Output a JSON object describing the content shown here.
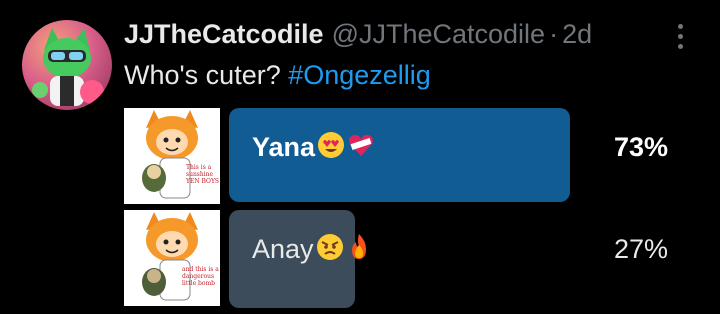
{
  "tweet": {
    "display_name": "JJTheCatcodile",
    "handle": "@JJTheCatcodile",
    "separator": "·",
    "time": "2d",
    "text_prefix": "Who's cuter? ",
    "hashtag": "#Ongezellig"
  },
  "poll": {
    "options": [
      {
        "label": "Yana",
        "percent": "73%",
        "value": 73,
        "winner": true,
        "emoji": [
          "heart-eyes-emoji",
          "bandaged-heart-emoji"
        ]
      },
      {
        "label": "Anay",
        "percent": "27%",
        "value": 27,
        "winner": false,
        "emoji": [
          "angry-face-emoji",
          "fire-emoji"
        ]
      }
    ],
    "thumb_texts": [
      {
        "caption_1": "This is a",
        "caption_2": "sunshine",
        "caption_3": "YEN BOYS"
      },
      {
        "caption_1": "and this is a",
        "caption_2": "dangerous",
        "caption_3": "little bomb"
      }
    ]
  },
  "colors": {
    "background": "#000000",
    "winner_bar": "#115c92",
    "other_bar": "#3c4c5a",
    "hashtag": "#1d9bf0",
    "muted": "#71767b"
  }
}
